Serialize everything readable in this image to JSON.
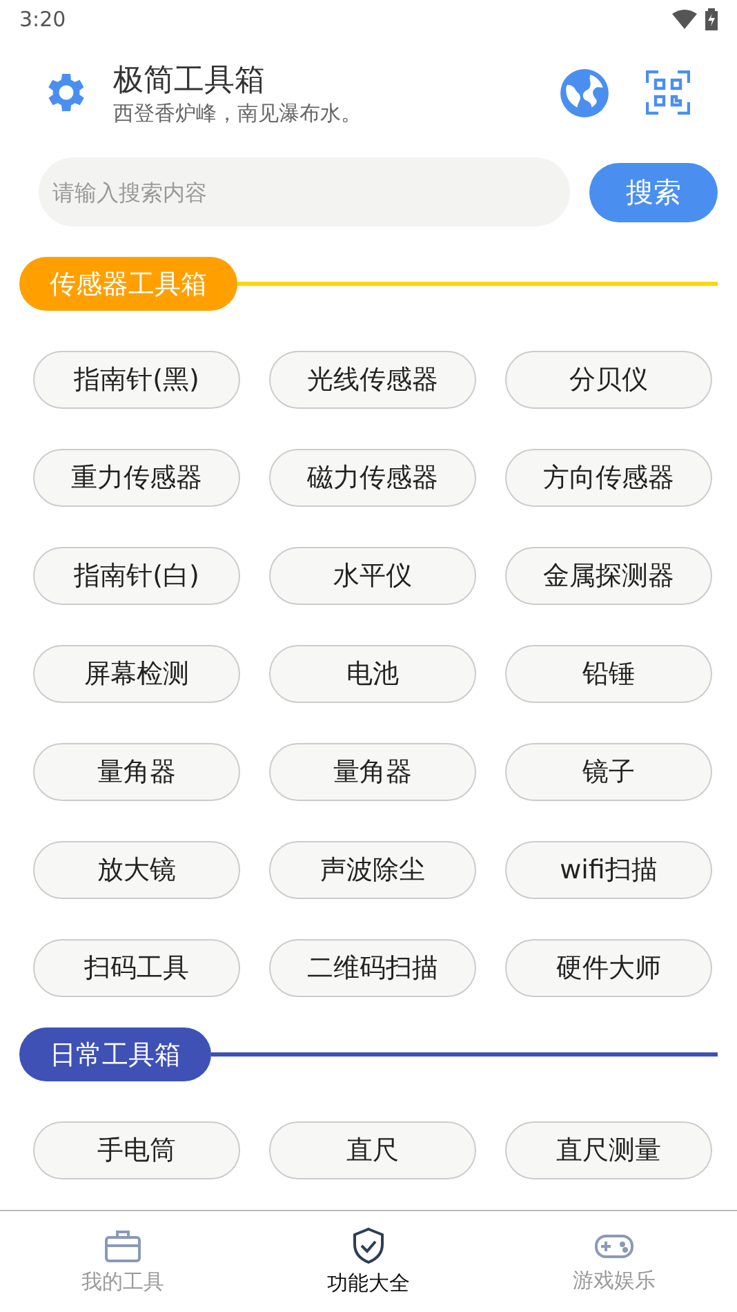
{
  "status_bar": {
    "time": "3:20"
  },
  "header": {
    "title": "极简工具箱",
    "subtitle": "西登香炉峰，南见瀑布水。"
  },
  "search": {
    "placeholder": "请输入搜索内容",
    "button": "搜索"
  },
  "sections": [
    {
      "title": "传感器工具箱",
      "color": "#ffa000",
      "line": {
        "color": "#ffd600"
      },
      "items": [
        "指南针(黑)",
        "光线传感器",
        "分贝仪",
        "重力传感器",
        "磁力传感器",
        "方向传感器",
        "指南针(白)",
        "水平仪",
        "金属探测器",
        "屏幕检测",
        "电池",
        "铅锤",
        "量角器",
        "量角器",
        "镜子",
        "放大镜",
        "声波除尘",
        "wifi扫描",
        "扫码工具",
        "二维码扫描",
        "硬件大师"
      ]
    },
    {
      "title": "日常工具箱",
      "color": "#3f51b5",
      "line": {
        "color": "#3f51b5"
      },
      "items": [
        "手电筒",
        "直尺",
        "直尺测量"
      ]
    }
  ],
  "bottom_nav": [
    {
      "label": "我的工具",
      "kind": "toolbox",
      "selected": false
    },
    {
      "label": "功能大全",
      "kind": "shield",
      "selected": true
    },
    {
      "label": "游戏娱乐",
      "kind": "game",
      "selected": false
    }
  ]
}
